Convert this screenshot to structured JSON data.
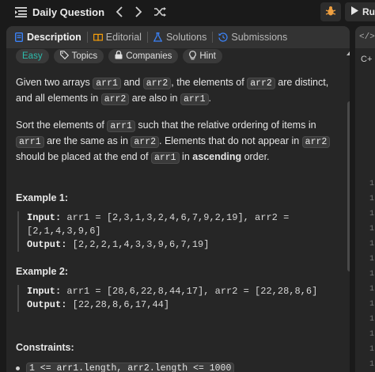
{
  "topbar": {
    "title": "Daily Question",
    "run_label": "Ru"
  },
  "tabs": [
    {
      "label": "Description",
      "icon": "doc-icon",
      "active": true
    },
    {
      "label": "Editorial",
      "icon": "book-icon",
      "active": false
    },
    {
      "label": "Solutions",
      "icon": "flask-icon",
      "active": false
    },
    {
      "label": "Submissions",
      "icon": "history-icon",
      "active": false
    }
  ],
  "pills": {
    "difficulty": "Easy",
    "topics": "Topics",
    "companies": "Companies",
    "hint": "Hint"
  },
  "problem": {
    "p1_a": "Given two arrays ",
    "p1_code1": "arr1",
    "p1_b": " and ",
    "p1_code2": "arr2",
    "p1_c": ", the elements of ",
    "p1_code3": "arr2",
    "p1_d": " are distinct, and all elements in ",
    "p1_code4": "arr2",
    "p1_e": " are also in ",
    "p1_code5": "arr1",
    "p1_f": ".",
    "p2_a": "Sort the elements of ",
    "p2_code1": "arr1",
    "p2_b": " such that the relative ordering of items in ",
    "p2_code2": "arr1",
    "p2_c": " are the same as in ",
    "p2_code3": "arr2",
    "p2_d": ". Elements that do not appear in ",
    "p2_code4": "arr2",
    "p2_e": " should be placed at the end of ",
    "p2_code5": "arr1",
    "p2_f": " in ",
    "p2_bold": "ascending",
    "p2_g": " order."
  },
  "examples": [
    {
      "heading": "Example 1:",
      "input_label": "Input:",
      "input_value": " arr1 = [2,3,1,3,2,4,6,7,9,2,19], arr2 = [2,1,4,3,9,6]",
      "output_label": "Output:",
      "output_value": " [2,2,2,1,4,3,3,9,6,7,19]"
    },
    {
      "heading": "Example 2:",
      "input_label": "Input:",
      "input_value": " arr1 = [28,6,22,8,44,17], arr2 = [22,28,8,6]",
      "output_label": "Output:",
      "output_value": " [22,28,8,6,17,44]"
    }
  ],
  "constraints": {
    "heading": "Constraints:",
    "items": [
      "1 <= arr1.length, arr2.length <= 1000"
    ]
  },
  "right_panel": {
    "top_label": "</>",
    "lang": "C+",
    "line_numbers": [
      "1",
      "1",
      "1",
      "1",
      "1",
      "1",
      "1",
      "1",
      "1",
      "1",
      "1",
      "1",
      "1"
    ]
  },
  "colors": {
    "easy": "#2cbbac",
    "accent_bug": "#f0a040",
    "tab_icon_description": "#3b82f6",
    "tab_icon_editorial": "#f59e0b",
    "tab_icon_solutions": "#3b82f6",
    "tab_icon_submissions": "#3b82f6"
  }
}
